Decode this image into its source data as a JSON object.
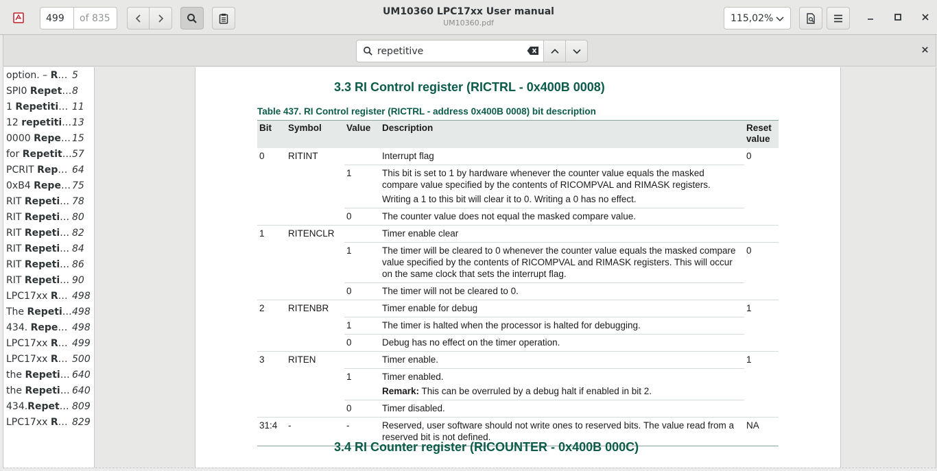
{
  "header": {
    "page_number": "499",
    "page_of": "of 835",
    "title": "UM10360 LPC17xx User manual",
    "subtitle": "UM10360.pdf",
    "zoom": "115,02%"
  },
  "search": {
    "query": "repetitive"
  },
  "sidebar": {
    "results": [
      {
        "pre": "option. – ",
        "match": "Re...",
        "page": "5"
      },
      {
        "pre": "SPI0 ",
        "match": "Repeti...",
        "page": "8"
      },
      {
        "pre": "1 ",
        "match": "Repetitiv...",
        "page": "11"
      },
      {
        "pre": "12 ",
        "match": "repetiti...",
        "page": "13"
      },
      {
        "pre": "0000 ",
        "match": "Repet...",
        "page": "15"
      },
      {
        "pre": "for ",
        "match": "Repetiti...",
        "page": "57"
      },
      {
        "pre": "PCRIT ",
        "match": "Repe...",
        "page": "64"
      },
      {
        "pre": "0xB4 ",
        "match": "Repet...",
        "page": "75"
      },
      {
        "pre": "RIT ",
        "match": "Repetit...",
        "page": "78"
      },
      {
        "pre": "RIT ",
        "match": "Repetit...",
        "page": "80"
      },
      {
        "pre": "RIT ",
        "match": "Repetit...",
        "page": "82"
      },
      {
        "pre": "RIT ",
        "match": "Repetit...",
        "page": "84"
      },
      {
        "pre": "RIT ",
        "match": "Repetit...",
        "page": "86"
      },
      {
        "pre": "RIT ",
        "match": "Repetit...",
        "page": "90"
      },
      {
        "pre": "LPC17xx ",
        "match": "Re...",
        "page": "498"
      },
      {
        "pre": "The ",
        "match": "Repetit...",
        "page": "498"
      },
      {
        "pre": "434. ",
        "match": "Repeti...",
        "page": "498"
      },
      {
        "pre": "LPC17xx ",
        "match": "Re...",
        "page": "499"
      },
      {
        "pre": "LPC17xx ",
        "match": "Re...",
        "page": "500"
      },
      {
        "pre": "the ",
        "match": "Repetit...",
        "page": "640"
      },
      {
        "pre": "the ",
        "match": "Repetit...",
        "page": "640"
      },
      {
        "pre": "434.",
        "match": "Repetit...",
        "page": "809"
      },
      {
        "pre": "LPC17xx ",
        "match": "Re...",
        "page": "829"
      }
    ]
  },
  "document": {
    "section_33": "3.3   RI Control register (RICTRL - 0x400B 0008)",
    "table_caption": "Table 437.  RI Control register (RICTRL - address 0x400B 0008) bit description",
    "section_34": "3.4   RI Counter register (RICOUNTER - 0x400B 000C)",
    "headers": {
      "bit": "Bit",
      "symbol": "Symbol",
      "value": "Value",
      "description": "Description",
      "reset": "Reset value"
    },
    "rows": {
      "r0_bit": "0",
      "r0_sym": "RITINT",
      "r0_desc": "Interrupt flag",
      "r0_reset": "0",
      "r0_v1": "1",
      "r0_v1_desc": "This bit is set to 1 by hardware whenever the counter value equals the masked compare value specified by the contents of RICOMPVAL and RIMASK registers.",
      "r0_v1_desc2": "Writing a 1 to this bit will clear it to 0. Writing a 0 has no effect.",
      "r0_v0": "0",
      "r0_v0_desc": "The counter value does not equal the masked compare value.",
      "r1_bit": "1",
      "r1_sym": "RITENCLR",
      "r1_desc": "Timer enable clear",
      "r1_v1": "1",
      "r1_v1_desc": "The timer will be cleared to 0 whenever the counter value equals the masked compare value specified by the contents of RICOMPVAL and RIMASK registers. This will occur on the same clock that sets the interrupt flag.",
      "r1_reset": "0",
      "r1_v0": "0",
      "r1_v0_desc": "The timer will not be cleared to 0.",
      "r2_bit": "2",
      "r2_sym": "RITENBR",
      "r2_desc": "Timer enable for debug",
      "r2_reset": "1",
      "r2_v1": "1",
      "r2_v1_desc": "The timer is halted when the processor is halted for debugging.",
      "r2_v0": "0",
      "r2_v0_desc": "Debug has no effect on the timer operation.",
      "r3_bit": "3",
      "r3_sym": "RITEN",
      "r3_desc": "Timer enable.",
      "r3_reset": "1",
      "r3_v1": "1",
      "r3_v1_desc": "Timer enabled.",
      "r3_remark_label": "Remark:",
      "r3_remark": " This can be overruled by a debug halt if enabled in bit 2.",
      "r3_v0": "0",
      "r3_v0_desc": "Timer disabled.",
      "r4_bit": "31:4",
      "r4_sym": "-",
      "r4_val": "-",
      "r4_desc": "Reserved, user software should not write ones to reserved bits. The value read from a reserved bit is not defined.",
      "r4_reset": "NA"
    }
  }
}
